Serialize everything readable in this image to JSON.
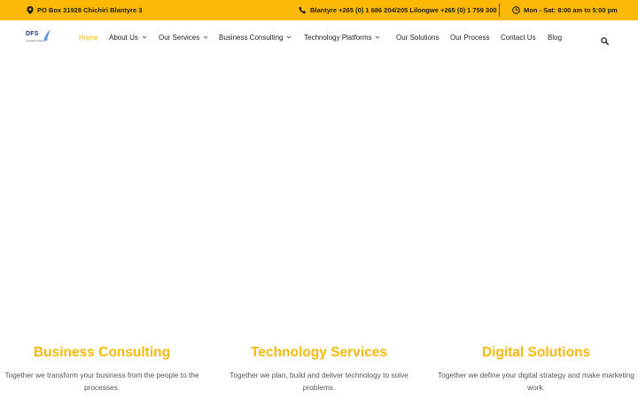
{
  "topbar": {
    "address": "PO Box 31928 Chichiri Blantyre 3",
    "phones": "Blantyre +265 (0) 1 686 204/205 Lilongwe +265 (0) 1 759 300",
    "hours": "Mon - Sat: 8:00 am to 5:00 pm",
    "background_color": "#fbb806"
  },
  "logo": {
    "text": "DFS",
    "subtext": "Consulting Group"
  },
  "nav": {
    "items": [
      {
        "label": "Home",
        "active": true,
        "dropdown": false
      },
      {
        "label": "About Us",
        "active": false,
        "dropdown": true
      },
      {
        "label": "Our Services",
        "active": false,
        "dropdown": true
      },
      {
        "label": "Business Consulting",
        "active": false,
        "dropdown": true
      },
      {
        "label": "Technology Platforms",
        "active": false,
        "dropdown": true
      },
      {
        "label": "Our Solutions",
        "active": false,
        "dropdown": false
      },
      {
        "label": "Our Process",
        "active": false,
        "dropdown": false
      },
      {
        "label": "Contact Us",
        "active": false,
        "dropdown": false
      },
      {
        "label": "Blog",
        "active": false,
        "dropdown": false
      }
    ],
    "active_color": "#f7b511",
    "search_icon": "search-icon"
  },
  "features": [
    {
      "title": "Business Consulting",
      "text": "Together we transform your business from the people to the processes."
    },
    {
      "title": "Technology Services",
      "text": "Together we plan, build and deliver technology to solve problems."
    },
    {
      "title": "Digital Solutions",
      "text": "Together we define your digital strategy and make marketing work."
    }
  ],
  "accent_color": "#f7b80c"
}
